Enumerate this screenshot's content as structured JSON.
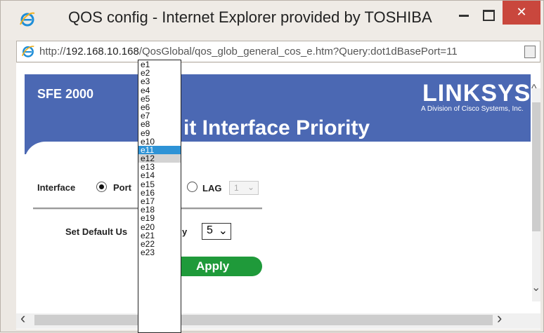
{
  "window": {
    "title": "QOS config - Internet Explorer provided by TOSHIBA",
    "min_icon": "minimize-icon",
    "max_icon": "maximize-icon",
    "close_icon": "close-icon",
    "close_glyph": "✕"
  },
  "address": {
    "url_prefix": "http://",
    "url_domain": "192.168.10.168",
    "url_path": "/QosGlobal/qos_glob_general_cos_e.htm?Query:dot1dBasePort=11"
  },
  "page": {
    "device": "SFE 2000",
    "brand": "LINKSYS",
    "brand_sub": "A Division of Cisco Systems, Inc.",
    "heading": "it Interface Priority",
    "interface_label": "Interface",
    "port_label": "Port",
    "lag_label": "LAG",
    "lag_value": "1",
    "default_label": "Set Default Us",
    "default_suffix": "y",
    "priority_value": "5",
    "apply_label": "Apply"
  },
  "dropdown": {
    "options": [
      "e1",
      "e2",
      "e3",
      "e4",
      "e5",
      "e6",
      "e7",
      "e8",
      "e9",
      "e10",
      "e11",
      "e12",
      "e13",
      "e14",
      "e15",
      "e16",
      "e17",
      "e18",
      "e19",
      "e20",
      "e21",
      "e22",
      "e23"
    ],
    "highlighted": "e11",
    "selected": "e12"
  },
  "colors": {
    "header_blue": "#4b68b3",
    "apply_green": "#1f9a3a",
    "highlight": "#2e93d6",
    "close_red": "#c9473d"
  }
}
